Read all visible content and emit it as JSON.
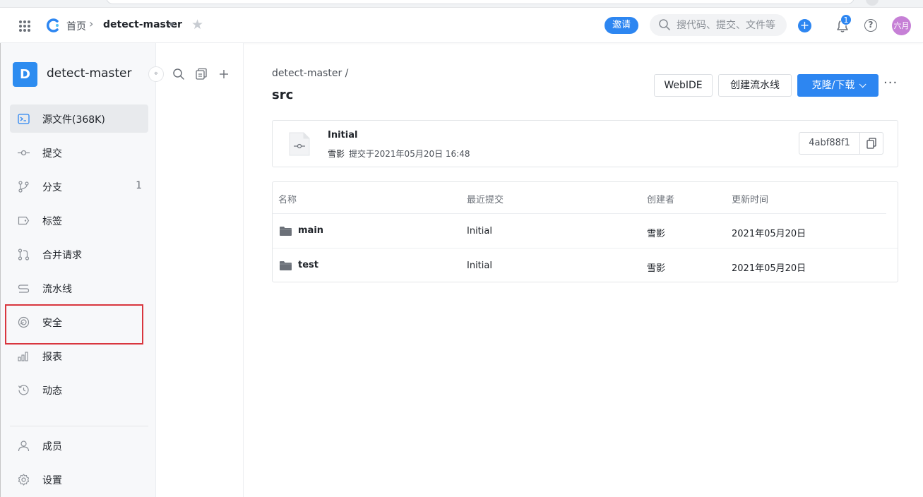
{
  "header": {
    "breadcrumb_home": "首页",
    "breadcrumb_sep": "›",
    "project": "detect-master",
    "invite_label": "邀请",
    "search_placeholder": "搜代码、提交、文件等",
    "notification_count": "1",
    "avatar_text": "六月",
    "icons": [
      "apps-grid-icon",
      "logo-icon",
      "chevron-right-icon",
      "caret-down-icon",
      "star-icon",
      "search-icon",
      "plus-circle-icon",
      "bell-icon",
      "help-icon"
    ]
  },
  "sidebar": {
    "project_initial": "D",
    "project_name": "detect-master",
    "pin_label": "⌖",
    "items": [
      {
        "label": "源文件(368K)",
        "icon": "terminal-icon",
        "active": true
      },
      {
        "label": "提交",
        "icon": "commit-icon"
      },
      {
        "label": "分支",
        "icon": "branch-icon",
        "count": "1"
      },
      {
        "label": "标签",
        "icon": "tag-icon"
      },
      {
        "label": "合并请求",
        "icon": "merge-request-icon"
      },
      {
        "label": "流水线",
        "icon": "pipeline-icon"
      },
      {
        "label": "安全",
        "icon": "shield-icon"
      },
      {
        "label": "报表",
        "icon": "chart-icon"
      },
      {
        "label": "动态",
        "icon": "history-icon"
      },
      {
        "label": "成员",
        "icon": "user-icon"
      },
      {
        "label": "设置",
        "icon": "gear-icon"
      }
    ]
  },
  "tree_panel": {
    "icons": [
      "search-icon",
      "file-copy-icon",
      "plus-icon"
    ]
  },
  "main": {
    "path_crumb": "detect-master  /",
    "path_title": "src",
    "buttons": {
      "webide": "WebIDE",
      "pipeline": "创建流水线",
      "clone": "克隆/下载"
    },
    "more_label": "···",
    "commit": {
      "title": "Initial",
      "author": "雪影",
      "when": "提交于2021年05月20日 16:48",
      "hash": "4abf88f1"
    },
    "table": {
      "headers": [
        "名称",
        "最近提交",
        "创建者",
        "更新时间"
      ],
      "rows": [
        {
          "name": "main",
          "commit": "Initial",
          "author": "雪影",
          "time": "2021年05月20日"
        },
        {
          "name": "test",
          "commit": "Initial",
          "author": "雪影",
          "time": "2021年05月20日"
        }
      ]
    }
  },
  "colors": {
    "accent": "#2d86f1",
    "sidebar_bg": "#f7f8fa",
    "highlight_border": "#d9363e",
    "avatar_bg": "#c680d6"
  }
}
